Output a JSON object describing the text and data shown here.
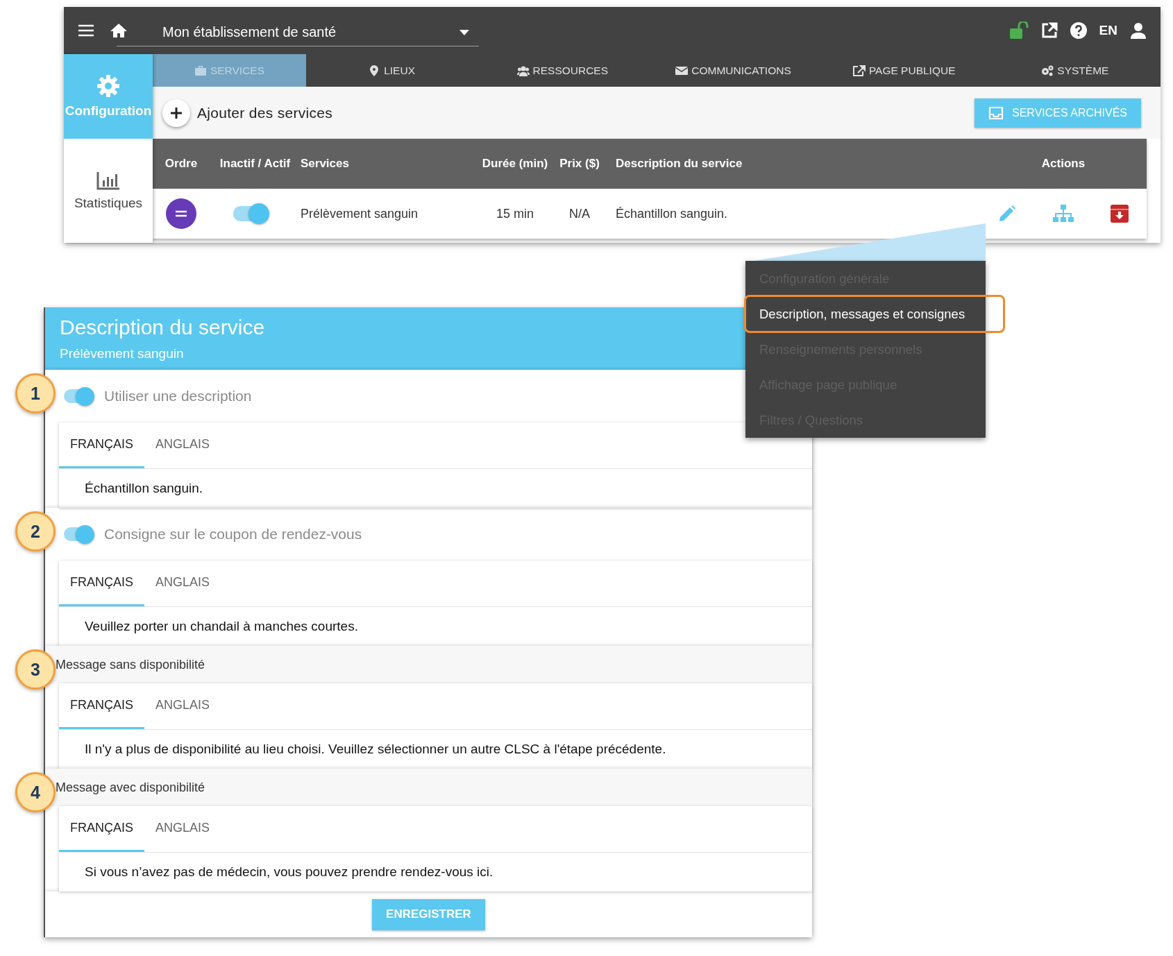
{
  "topbar": {
    "facility": "Mon établissement de santé",
    "language": "EN"
  },
  "nav_tabs": [
    {
      "label": "SERVICES",
      "selected": true
    },
    {
      "label": "LIEUX",
      "selected": false
    },
    {
      "label": "RESSOURCES",
      "selected": false
    },
    {
      "label": "COMMUNICATIONS",
      "selected": false
    },
    {
      "label": "PAGE PUBLIQUE",
      "selected": false
    },
    {
      "label": "SYSTÈME",
      "selected": false
    }
  ],
  "sidebar": [
    {
      "label": "Configuration",
      "selected": true
    },
    {
      "label": "Statistiques",
      "selected": false
    }
  ],
  "toolbar": {
    "add_label": "Ajouter des services",
    "archived_button": "SERVICES ARCHIVÉS"
  },
  "table": {
    "columns": [
      "Ordre",
      "Inactif / Actif",
      "Services",
      "Durée (min)",
      "Prix ($)",
      "Description du service",
      "Actions"
    ],
    "rows": [
      {
        "active": true,
        "service": "Prélèvement sanguin",
        "duration": "15 min",
        "price": "N/A",
        "description": "Échantillon sanguin."
      }
    ]
  },
  "menu": [
    {
      "label": "Configuration générale",
      "selected": false
    },
    {
      "label": "Description, messages et consignes",
      "selected": true
    },
    {
      "label": "Renseignements personnels",
      "selected": false
    },
    {
      "label": "Affichage page publique",
      "selected": false
    },
    {
      "label": "Filtres / Questions",
      "selected": false
    }
  ],
  "dialog": {
    "title": "Description du service",
    "subtitle": "Prélèvement sanguin",
    "sections": [
      {
        "callout": "1",
        "kind": "toggle",
        "label": "Utiliser une description",
        "on": true,
        "tabs": [
          {
            "label": "FRANÇAIS",
            "selected": true
          },
          {
            "label": "ANGLAIS",
            "selected": false
          }
        ],
        "text": "Échantillon sanguin."
      },
      {
        "callout": "2",
        "kind": "toggle",
        "label": "Consigne sur le coupon de rendez-vous",
        "on": true,
        "tabs": [
          {
            "label": "FRANÇAIS",
            "selected": true
          },
          {
            "label": "ANGLAIS",
            "selected": false
          }
        ],
        "text": "Veuillez porter un chandail à manches courtes."
      },
      {
        "callout": "3",
        "kind": "label",
        "label": "Message sans disponibilité",
        "tabs": [
          {
            "label": "FRANÇAIS",
            "selected": true
          },
          {
            "label": "ANGLAIS",
            "selected": false
          }
        ],
        "text": "Il n'y a plus de disponibilité au lieu choisi. Veuillez sélectionner un autre CLSC à l'étape précédente."
      },
      {
        "callout": "4",
        "kind": "label",
        "label": "Message avec disponibilité",
        "tabs": [
          {
            "label": "FRANÇAIS",
            "selected": true
          },
          {
            "label": "ANGLAIS",
            "selected": false
          }
        ],
        "text": "Si vous n’avez pas de médecin, vous pouvez prendre rendez-vous ici."
      }
    ],
    "save_button": "ENREGISTRER"
  }
}
